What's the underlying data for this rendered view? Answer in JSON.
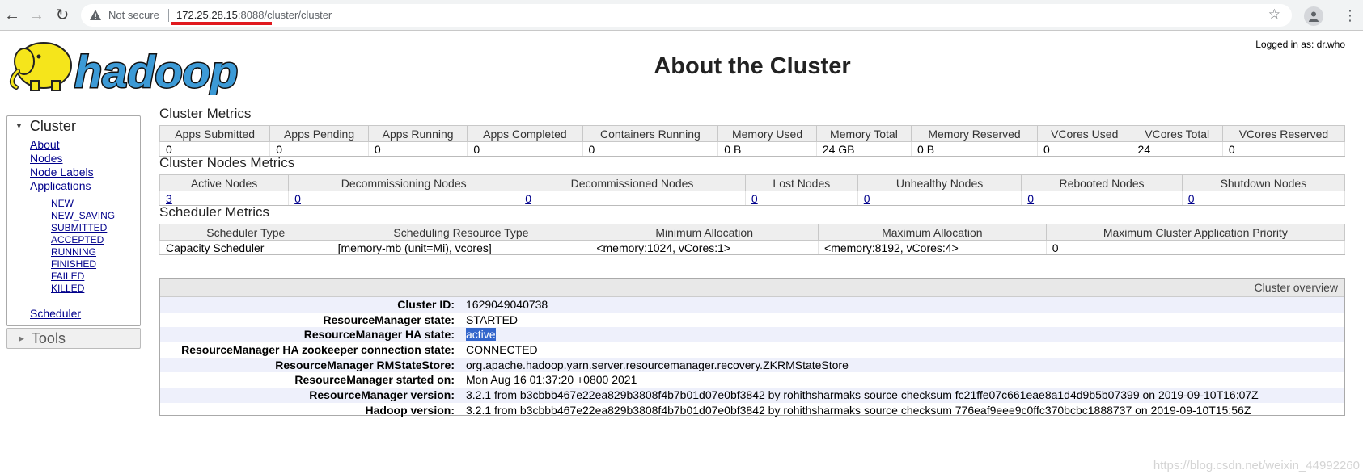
{
  "browser": {
    "security_label": "Not secure",
    "url_host": "172.25.28.15",
    "url_port": ":8088",
    "url_path": "/cluster/cluster"
  },
  "header": {
    "logo_text": "hadoop",
    "title": "About the Cluster",
    "logged_in": "Logged in as: dr.who"
  },
  "sidebar": {
    "cluster_label": "Cluster",
    "links": [
      "About",
      "Nodes",
      "Node Labels",
      "Applications"
    ],
    "app_states": [
      "NEW",
      "NEW_SAVING",
      "SUBMITTED",
      "ACCEPTED",
      "RUNNING",
      "FINISHED",
      "FAILED",
      "KILLED"
    ],
    "scheduler": "Scheduler",
    "tools_label": "Tools"
  },
  "cluster_metrics": {
    "title": "Cluster Metrics",
    "headers": [
      "Apps Submitted",
      "Apps Pending",
      "Apps Running",
      "Apps Completed",
      "Containers Running",
      "Memory Used",
      "Memory Total",
      "Memory Reserved",
      "VCores Used",
      "VCores Total",
      "VCores Reserved"
    ],
    "values": [
      "0",
      "0",
      "0",
      "0",
      "0",
      "0 B",
      "24 GB",
      "0 B",
      "0",
      "24",
      "0"
    ]
  },
  "nodes_metrics": {
    "title": "Cluster Nodes Metrics",
    "headers": [
      "Active Nodes",
      "Decommissioning Nodes",
      "Decommissioned Nodes",
      "Lost Nodes",
      "Unhealthy Nodes",
      "Rebooted Nodes",
      "Shutdown Nodes"
    ],
    "values": [
      "3",
      "0",
      "0",
      "0",
      "0",
      "0",
      "0"
    ]
  },
  "scheduler_metrics": {
    "title": "Scheduler Metrics",
    "headers": [
      "Scheduler Type",
      "Scheduling Resource Type",
      "Minimum Allocation",
      "Maximum Allocation",
      "Maximum Cluster Application Priority"
    ],
    "values": [
      "Capacity Scheduler",
      "[memory-mb (unit=Mi), vcores]",
      "<memory:1024, vCores:1>",
      "<memory:8192, vCores:4>",
      "0"
    ]
  },
  "overview": {
    "title": "Cluster overview",
    "rows": [
      {
        "label": "Cluster ID:",
        "value": "1629049040738"
      },
      {
        "label": "ResourceManager state:",
        "value": "STARTED"
      },
      {
        "label": "ResourceManager HA state:",
        "value": "active"
      },
      {
        "label": "ResourceManager HA zookeeper connection state:",
        "value": "CONNECTED"
      },
      {
        "label": "ResourceManager RMStateStore:",
        "value": "org.apache.hadoop.yarn.server.resourcemanager.recovery.ZKRMStateStore"
      },
      {
        "label": "ResourceManager started on:",
        "value": "Mon Aug 16 01:37:20 +0800 2021"
      },
      {
        "label": "ResourceManager version:",
        "value": "3.2.1 from b3cbbb467e22ea829b3808f4b7b01d07e0bf3842 by rohithsharmaks source checksum fc21ffe07c661eae8a1d4d9b5b07399 on 2019-09-10T16:07Z"
      },
      {
        "label": "Hadoop version:",
        "value": "3.2.1 from b3cbbb467e22ea829b3808f4b7b01d07e0bf3842 by rohithsharmaks source checksum 776eaf9eee9c0ffc370bcbc1888737 on 2019-09-10T15:56Z"
      }
    ]
  },
  "watermark": "https://blog.csdn.net/weixin_44992260",
  "colors": {
    "link": "#00008b",
    "highlight": "#3366cc",
    "url_underline": "#e0191e"
  }
}
